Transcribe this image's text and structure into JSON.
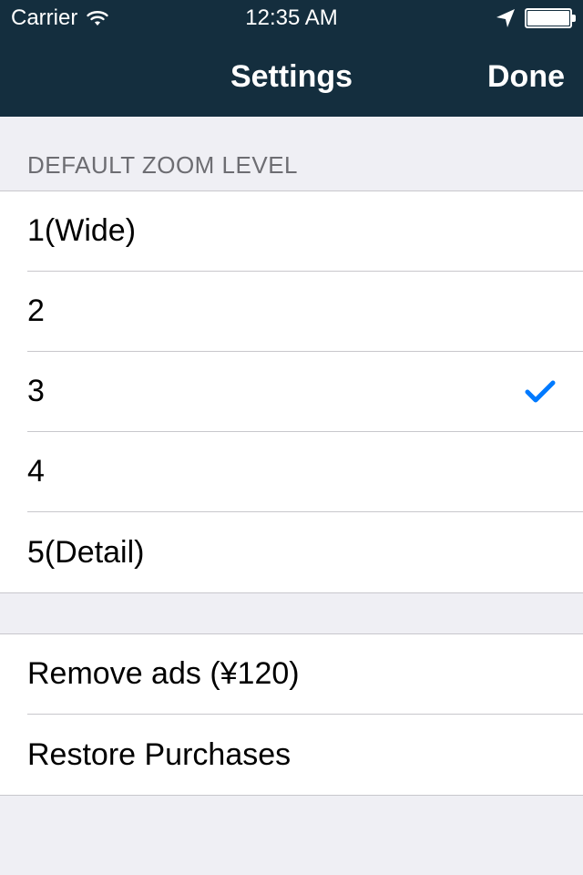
{
  "status": {
    "carrier": "Carrier",
    "time": "12:35 AM"
  },
  "nav": {
    "title": "Settings",
    "done": "Done"
  },
  "zoom": {
    "header": "DEFAULT ZOOM LEVEL",
    "selected": 2,
    "items": [
      {
        "label": "1(Wide)"
      },
      {
        "label": "2"
      },
      {
        "label": "3"
      },
      {
        "label": "4"
      },
      {
        "label": "5(Detail)"
      }
    ]
  },
  "purchases": {
    "remove_ads": "Remove ads (¥120)",
    "restore": "Restore Purchases"
  }
}
